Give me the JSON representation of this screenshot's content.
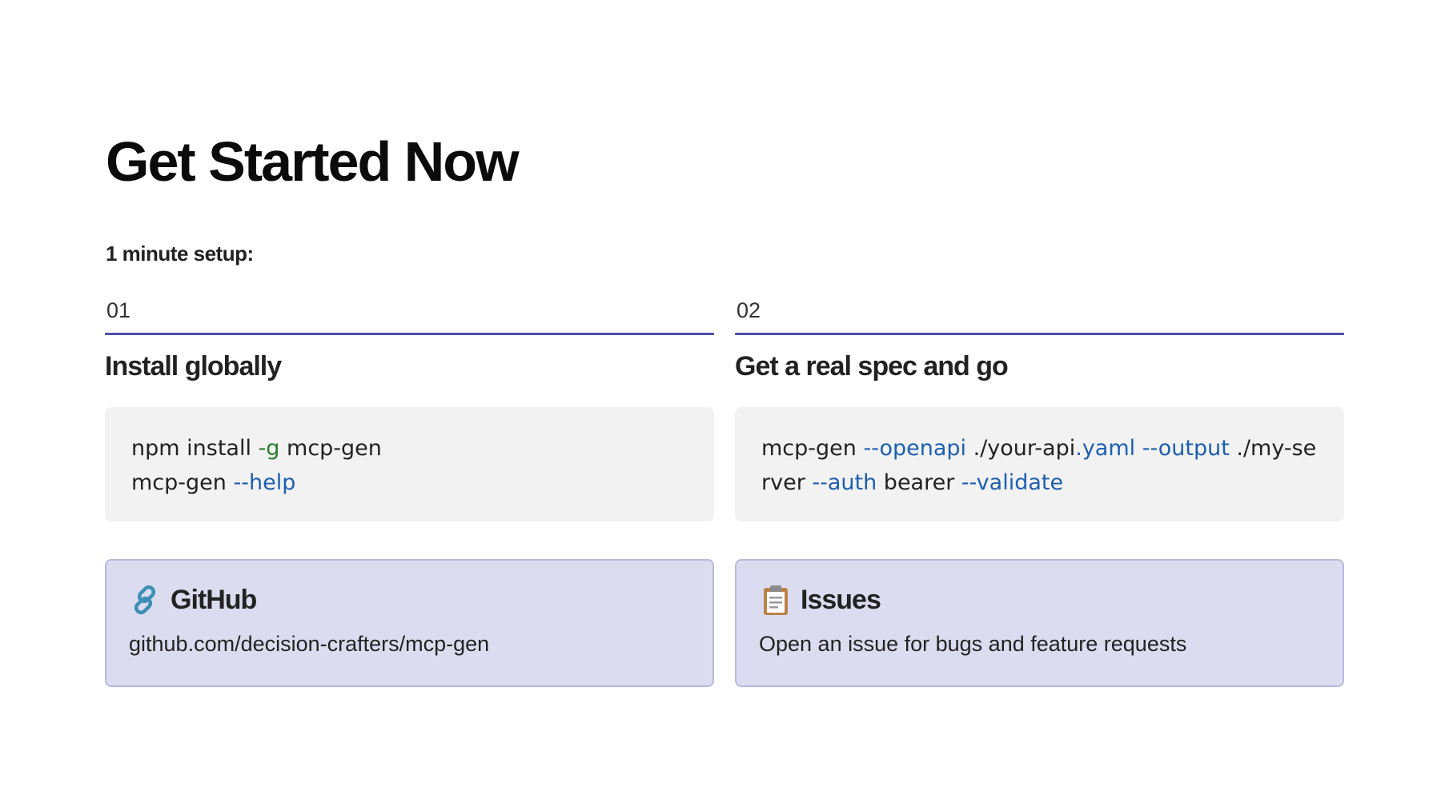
{
  "title": "Get Started Now",
  "subtitle": "1 minute setup:",
  "steps": [
    {
      "number": "01",
      "title": "Install globally",
      "code": [
        [
          {
            "t": "npm install ",
            "k": "plain"
          },
          {
            "t": "-g",
            "k": "green"
          },
          {
            "t": " mcp-gen",
            "k": "plain"
          }
        ],
        [
          {
            "t": "mcp-gen ",
            "k": "plain"
          },
          {
            "t": "--help",
            "k": "flag"
          }
        ]
      ]
    },
    {
      "number": "02",
      "title": "Get a real spec and go",
      "code": [
        [
          {
            "t": "mcp-gen ",
            "k": "plain"
          },
          {
            "t": "--openapi",
            "k": "flag"
          },
          {
            "t": " ./your-api",
            "k": "plain"
          },
          {
            "t": ".yaml",
            "k": "flag"
          },
          {
            "t": " ",
            "k": "plain"
          },
          {
            "t": "--output",
            "k": "flag"
          },
          {
            "t": " ./my-server ",
            "k": "plain"
          },
          {
            "t": "--auth",
            "k": "flag"
          },
          {
            "t": " bearer ",
            "k": "plain"
          },
          {
            "t": "--validate",
            "k": "flag"
          }
        ]
      ]
    }
  ],
  "cards": [
    {
      "icon": "link-icon",
      "title": "GitHub",
      "text": "github.com/decision-crafters/mcp-gen"
    },
    {
      "icon": "clipboard-icon",
      "title": "Issues",
      "text": "Open an issue for bugs and feature requests"
    }
  ],
  "colors": {
    "accent_line": "#4a4fa8",
    "code_flag": "#1d5fb0",
    "code_green": "#2d7d32",
    "card_bg": "#dcdcf0",
    "code_bg": "#f2f2f2"
  }
}
